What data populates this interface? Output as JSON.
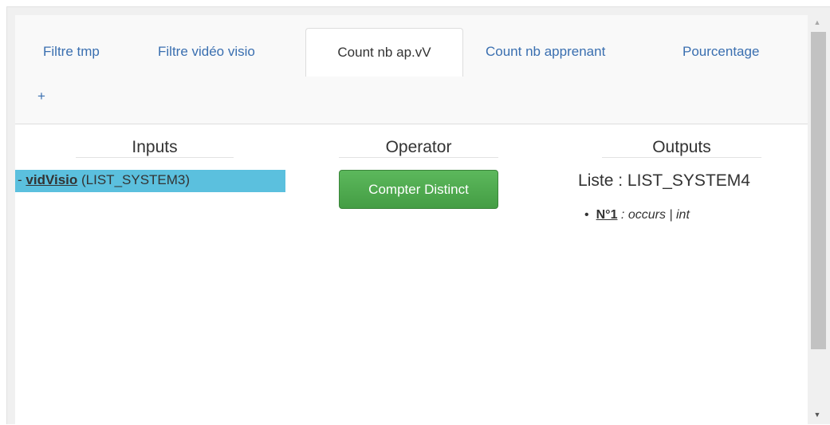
{
  "tabs": [
    {
      "label": "Filtre tmp",
      "active": false
    },
    {
      "label": "Filtre vidéo visio",
      "active": false
    },
    {
      "label": "Count nb ap.vV",
      "active": true
    },
    {
      "label": "Count nb apprenant",
      "active": false
    },
    {
      "label": "Pourcentage",
      "active": false
    }
  ],
  "add_tab_label": "+",
  "columns": {
    "inputs_title": "Inputs",
    "operator_title": "Operator",
    "outputs_title": "Outputs"
  },
  "inputs": {
    "prefix": "- ",
    "name": "vidVisio",
    "type": " (LIST_SYSTEM3)"
  },
  "operator": {
    "button_label": "Compter Distinct",
    "color": "#5cb85c"
  },
  "outputs": {
    "list_title": "Liste : LIST_SYSTEM4",
    "fields": [
      {
        "bullet": "•",
        "number": "N°1",
        "sep": " : ",
        "name": "occurs",
        "pipe": " | ",
        "type": "int"
      }
    ]
  },
  "scrollbar": {
    "up_icon": "▲",
    "down_icon": "▼"
  },
  "colors": {
    "link": "#3a6fb0",
    "selected_row": "#5bc0de",
    "button_green": "#5cb85c"
  }
}
